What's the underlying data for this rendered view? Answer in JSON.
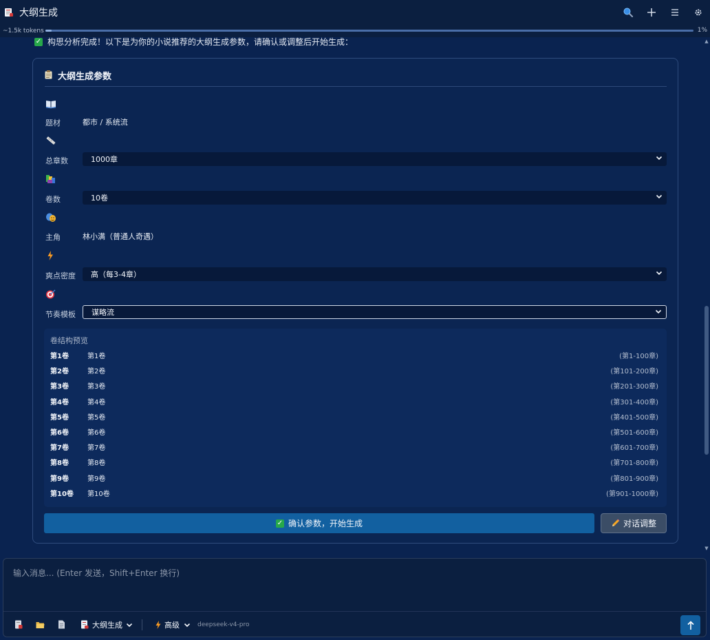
{
  "window": {
    "title": "大纲生成"
  },
  "token_usage": {
    "label": "~1.5k tokens",
    "percent_text": "1%",
    "fraction": 0.01
  },
  "message": {
    "intro": "构思分析完成！以下是为你的小说推荐的大纲生成参数，请确认或调整后开始生成："
  },
  "panel": {
    "title": "大纲生成参数",
    "fields": {
      "genre": {
        "label": "题材",
        "value": "都市 / 系统流"
      },
      "chapters": {
        "label": "总章数",
        "value": "1000章"
      },
      "volumes": {
        "label": "卷数",
        "value": "10卷"
      },
      "protagonist": {
        "label": "主角",
        "value": "林小满（普通人奇遇）"
      },
      "density": {
        "label": "爽点密度",
        "value": "高（每3-4章）"
      },
      "rhythm": {
        "label": "节奏模板",
        "value": "谋略流"
      }
    },
    "preview": {
      "title": "卷结构预览",
      "rows": [
        {
          "vol": "第1卷",
          "name": "第1卷",
          "range": "(第1-100章)"
        },
        {
          "vol": "第2卷",
          "name": "第2卷",
          "range": "(第101-200章)"
        },
        {
          "vol": "第3卷",
          "name": "第3卷",
          "range": "(第201-300章)"
        },
        {
          "vol": "第4卷",
          "name": "第4卷",
          "range": "(第301-400章)"
        },
        {
          "vol": "第5卷",
          "name": "第5卷",
          "range": "(第401-500章)"
        },
        {
          "vol": "第6卷",
          "name": "第6卷",
          "range": "(第501-600章)"
        },
        {
          "vol": "第7卷",
          "name": "第7卷",
          "range": "(第601-700章)"
        },
        {
          "vol": "第8卷",
          "name": "第8卷",
          "range": "(第701-800章)"
        },
        {
          "vol": "第9卷",
          "name": "第9卷",
          "range": "(第801-900章)"
        },
        {
          "vol": "第10卷",
          "name": "第10卷",
          "range": "(第901-1000章)"
        }
      ]
    },
    "confirm_label": "确认参数，开始生成",
    "chat_label": "对话调整"
  },
  "composer": {
    "placeholder": "输入消息... (Enter 发送，Shift+Enter 换行)",
    "mode_label": "大纲生成",
    "level_label": "高级",
    "model_name": "deepseek-v4-pro"
  },
  "colors": {
    "background": "#0a2350",
    "accent": "#1260a0",
    "success": "#27a84a",
    "titlebar": "#0b1f40"
  }
}
